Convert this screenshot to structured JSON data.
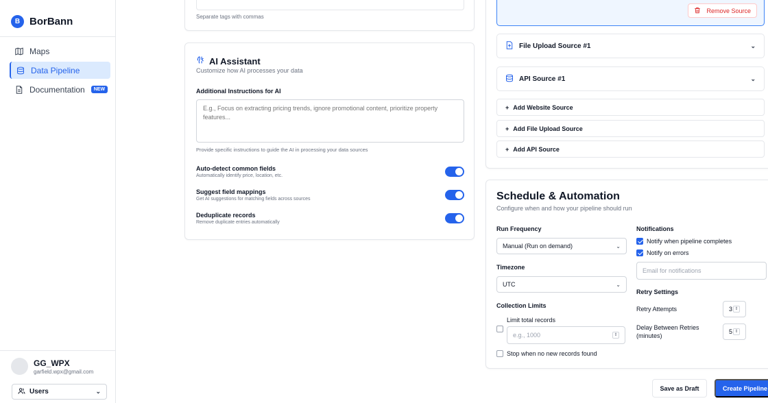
{
  "brand": {
    "logo_letter": "B",
    "name": "BorBann"
  },
  "sidebar": {
    "items": [
      {
        "label": "Maps",
        "icon": "map-icon"
      },
      {
        "label": "Data Pipeline",
        "icon": "database-icon",
        "active": true
      },
      {
        "label": "Documentation",
        "icon": "document-icon",
        "badge": "NEW"
      }
    ]
  },
  "user": {
    "name": "GG_WPX",
    "email": "garfield.wpx@gmail.com",
    "role_select": "Users"
  },
  "tags": {
    "helper": "Separate tags with commas"
  },
  "ai": {
    "title": "AI Assistant",
    "subtitle": "Customize how AI processes your data",
    "instructions_label": "Additional Instructions for AI",
    "instructions_placeholder": "E.g., Focus on extracting pricing trends, ignore promotional content, prioritize property features...",
    "instructions_helper": "Provide specific instructions to guide the AI in processing your data sources",
    "toggles": [
      {
        "label": "Auto-detect common fields",
        "desc": "Automatically identify price, location, etc.",
        "on": true
      },
      {
        "label": "Suggest field mappings",
        "desc": "Get AI suggestions for matching fields across sources",
        "on": true
      },
      {
        "label": "Deduplicate records",
        "desc": "Remove duplicate entries automatically",
        "on": true
      }
    ]
  },
  "sources": {
    "remove_label": "Remove Source",
    "items": [
      {
        "label": "File Upload Source #1",
        "icon": "file-upload-icon"
      },
      {
        "label": "API Source #1",
        "icon": "database-icon"
      }
    ],
    "add_buttons": [
      {
        "label": "Add Website Source"
      },
      {
        "label": "Add File Upload Source"
      },
      {
        "label": "Add API Source"
      }
    ]
  },
  "schedule": {
    "title": "Schedule & Automation",
    "subtitle": "Configure when and how your pipeline should run",
    "run_frequency_label": "Run Frequency",
    "run_frequency_value": "Manual (Run on demand)",
    "timezone_label": "Timezone",
    "timezone_value": "UTC",
    "collection_limits_label": "Collection Limits",
    "limit_total_label": "Limit total records",
    "limit_total_placeholder": "e.g., 1000",
    "stop_label": "Stop when no new records found",
    "notifications_label": "Notifications",
    "notify_complete": "Notify when pipeline completes",
    "notify_errors": "Notify on errors",
    "email_placeholder": "Email for notifications",
    "retry_label": "Retry Settings",
    "retry_attempts_label": "Retry Attempts",
    "retry_attempts_value": "3",
    "delay_label_line1": "Delay Between Retries",
    "delay_label_line2": "(minutes)",
    "delay_value": "5"
  },
  "footer": {
    "draft_label": "Save as Draft",
    "create_label": "Create Pipeline"
  },
  "colors": {
    "accent": "#2563eb",
    "danger": "#dc2626",
    "border": "#e5e7eb"
  }
}
